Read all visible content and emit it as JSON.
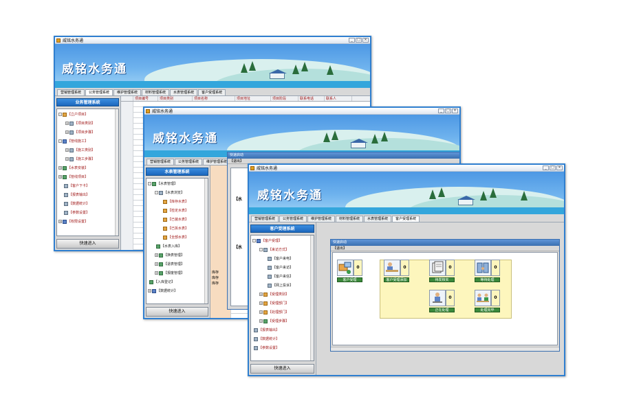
{
  "app_title": "威铭水务通",
  "banner_logo": "威铭水务通",
  "tabs": [
    "营销管理系统",
    "公务管理系统",
    "维护管理系统",
    "材料管理系统",
    "水表管理系统",
    "客户受理系统"
  ],
  "quick_entry": "快速进入",
  "window1": {
    "side_title": "业务管理系统",
    "grid_headers": [
      "项目编号",
      "项目类别",
      "项目名称",
      "项目地址",
      "项目阶段",
      "联系电话",
      "联系人"
    ],
    "tree": [
      {
        "label": "【立户项目】",
        "level": 0,
        "exp": "-"
      },
      {
        "label": "【项目类别】",
        "level": 1,
        "exp": "+"
      },
      {
        "label": "【项目步骤】",
        "level": 1,
        "exp": "+"
      },
      {
        "label": "【管线施工】",
        "level": 0,
        "exp": "-"
      },
      {
        "label": "【施工类别】",
        "level": 1,
        "exp": "+"
      },
      {
        "label": "【施工步骤】",
        "level": 1,
        "exp": "+"
      },
      {
        "label": "【水表安装】",
        "level": 0,
        "exp": "+"
      },
      {
        "label": "【管线项目】",
        "level": 0,
        "exp": "+"
      },
      {
        "label": "【客户下卡】",
        "level": 0,
        "exp": ""
      },
      {
        "label": "【报表输出】",
        "level": 0,
        "exp": ""
      },
      {
        "label": "【数据统计】",
        "level": 0,
        "exp": ""
      },
      {
        "label": "【参数设置】",
        "level": 0,
        "exp": ""
      },
      {
        "label": "【权限设置】",
        "level": 0,
        "exp": "+"
      }
    ]
  },
  "window2": {
    "side_title": "水表管理系统",
    "tree": [
      {
        "label": "【水表管理】",
        "level": 0,
        "exp": "-"
      },
      {
        "label": "【水表浏览】",
        "level": 1,
        "exp": "-"
      },
      {
        "label": "【库存水表】",
        "level": 2,
        "exp": ""
      },
      {
        "label": "【检定水表】",
        "level": 2,
        "exp": ""
      },
      {
        "label": "【已装水表】",
        "level": 2,
        "exp": ""
      },
      {
        "label": "【已拆水表】",
        "level": 2,
        "exp": ""
      },
      {
        "label": "【全部水表】",
        "level": 2,
        "exp": ""
      },
      {
        "label": "【水表入库】",
        "level": 1,
        "exp": ""
      },
      {
        "label": "【换表管理】",
        "level": 1,
        "exp": "+"
      },
      {
        "label": "【退表管理】",
        "level": 1,
        "exp": "+"
      },
      {
        "label": "【报废管理】",
        "level": 1,
        "exp": "+"
      },
      {
        "label": "【入库登记】",
        "level": 0,
        "exp": ""
      },
      {
        "label": "【数据统计】",
        "level": 0,
        "exp": "+"
      }
    ],
    "overlay_title": "快速启动",
    "overlay_menu": "【退出】",
    "overlay_labels": [
      "【水",
      "【水"
    ],
    "cell_labels": [
      "库存",
      "库存",
      "库存"
    ]
  },
  "window3": {
    "side_title": "客户受理系统",
    "tree": [
      {
        "label": "【客户受理】",
        "level": 0,
        "exp": "-"
      },
      {
        "label": "【来访方式】",
        "level": 1,
        "exp": "-"
      },
      {
        "label": "【客户来电】",
        "level": 2,
        "exp": ""
      },
      {
        "label": "【客户来访】",
        "level": 2,
        "exp": ""
      },
      {
        "label": "【客户来信】",
        "level": 2,
        "exp": ""
      },
      {
        "label": "【网上投诉】",
        "level": 2,
        "exp": ""
      },
      {
        "label": "【受理类别】",
        "level": 1,
        "exp": "+"
      },
      {
        "label": "【受理部门】",
        "level": 1,
        "exp": "+"
      },
      {
        "label": "【处理部门】",
        "level": 1,
        "exp": "+"
      },
      {
        "label": "【受理步骤】",
        "level": 1,
        "exp": "+"
      },
      {
        "label": "【报表输出】",
        "level": 0,
        "exp": ""
      },
      {
        "label": "【数据统计】",
        "level": 0,
        "exp": ""
      },
      {
        "label": "【参数设置】",
        "level": 0,
        "exp": ""
      }
    ],
    "quick_start": {
      "title": "快速启动",
      "menu": "【退出】",
      "cards": [
        {
          "caption": "客户受理",
          "count": "0"
        },
        {
          "caption": "客户受理添加",
          "count": "0"
        },
        {
          "caption": "待发核实",
          "count": "0"
        },
        {
          "caption": "等待处理",
          "count": "0"
        },
        {
          "caption": "正在处理",
          "count": "0"
        },
        {
          "caption": "处理完毕",
          "count": "0"
        }
      ]
    }
  }
}
